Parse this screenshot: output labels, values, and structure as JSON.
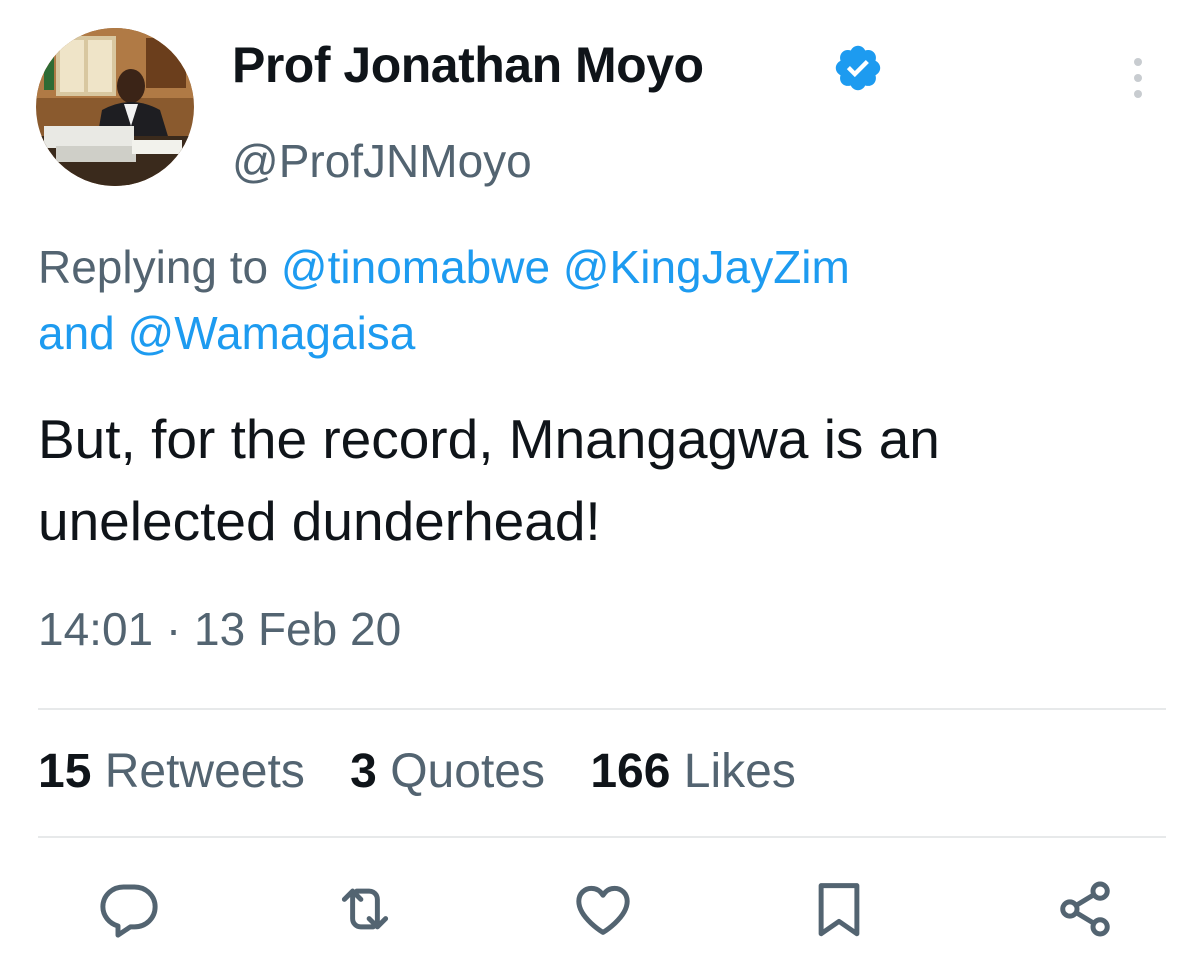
{
  "user": {
    "display_name": "Prof Jonathan Moyo",
    "handle": "@ProfJNMoyo",
    "verified_icon": "verified-badge-icon"
  },
  "reply": {
    "prefix": "Replying to ",
    "mention_1": "@tinomabwe",
    "mention_2": "@KingJayZim",
    "connector": "and",
    "mention_3": "@Wamagaisa"
  },
  "tweet": {
    "text": "But, for the record, Mnangagwa is an unelected dunderhead!",
    "timestamp": "14:01 · 13 Feb 20"
  },
  "stats": {
    "retweets_count": "15",
    "retweets_label": "Retweets",
    "quotes_count": "3",
    "quotes_label": "Quotes",
    "likes_count": "166",
    "likes_label": "Likes"
  },
  "actions": [
    "reply-icon",
    "retweet-icon",
    "like-icon",
    "bookmark-icon",
    "share-icon"
  ],
  "colors": {
    "accent": "#1d9bf0",
    "text": "#0f1419",
    "secondary": "#536471",
    "divider": "#e7e9ea"
  }
}
